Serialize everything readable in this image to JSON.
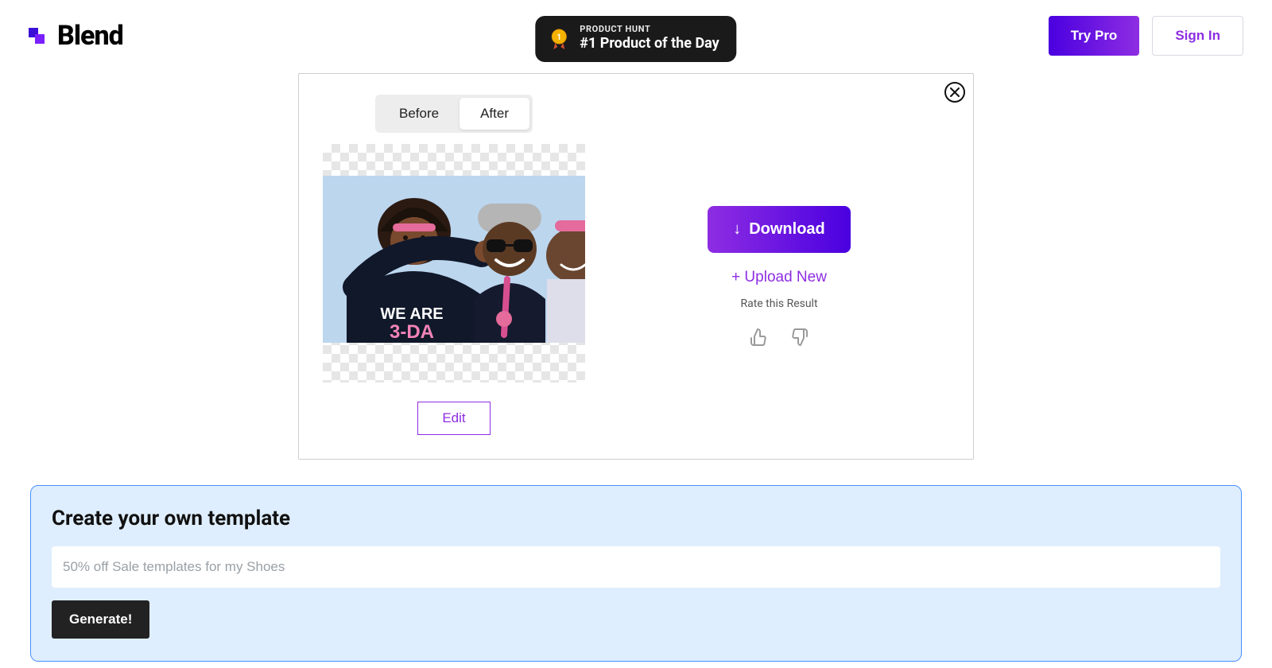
{
  "header": {
    "logo_text": "Blend",
    "product_hunt": {
      "top": "PRODUCT HUNT",
      "bottom": "#1 Product of the Day"
    },
    "try_pro": "Try Pro",
    "sign_in": "Sign In"
  },
  "card": {
    "toggle": {
      "before": "Before",
      "after": "After",
      "active": "after"
    },
    "edit": "Edit",
    "download": "Download",
    "upload_new": "+ Upload New",
    "rate_label": "Rate this Result",
    "image_text_line1": "WE ARE",
    "image_text_line2": "3-DA"
  },
  "template": {
    "title": "Create your own template",
    "placeholder": "50% off Sale templates for my Shoes",
    "value": "",
    "generate": "Generate!"
  }
}
